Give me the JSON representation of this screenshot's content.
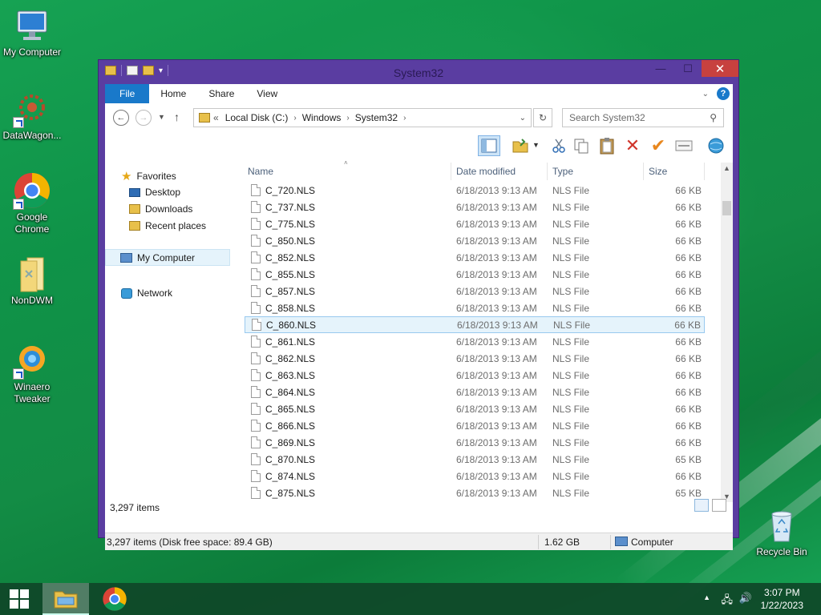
{
  "desktop": {
    "icons": [
      {
        "label": "My Computer"
      },
      {
        "label": "DataWagon..."
      },
      {
        "label": "Google Chrome"
      },
      {
        "label": "NonDWM"
      },
      {
        "label": "Winaero Tweaker"
      },
      {
        "label": "Recycle Bin"
      }
    ]
  },
  "window": {
    "title": "System32",
    "controls": {
      "minimize": "—",
      "maximize": "☐",
      "close": "✕"
    },
    "ribbon_tabs": [
      "File",
      "Home",
      "Share",
      "View"
    ],
    "help": "?",
    "address": {
      "prefix": "«",
      "crumbs": [
        "Local Disk (C:)",
        "Windows",
        "System32"
      ]
    },
    "search_placeholder": "Search System32",
    "nav": {
      "favorites": "Favorites",
      "desktop": "Desktop",
      "downloads": "Downloads",
      "recent": "Recent places",
      "computer": "My Computer",
      "network": "Network"
    },
    "columns": {
      "name": "Name",
      "date": "Date modified",
      "type": "Type",
      "size": "Size"
    },
    "files": [
      {
        "name": "C_720.NLS",
        "date": "6/18/2013 9:13 AM",
        "type": "NLS File",
        "size": "66 KB"
      },
      {
        "name": "C_737.NLS",
        "date": "6/18/2013 9:13 AM",
        "type": "NLS File",
        "size": "66 KB"
      },
      {
        "name": "C_775.NLS",
        "date": "6/18/2013 9:13 AM",
        "type": "NLS File",
        "size": "66 KB"
      },
      {
        "name": "C_850.NLS",
        "date": "6/18/2013 9:13 AM",
        "type": "NLS File",
        "size": "66 KB"
      },
      {
        "name": "C_852.NLS",
        "date": "6/18/2013 9:13 AM",
        "type": "NLS File",
        "size": "66 KB"
      },
      {
        "name": "C_855.NLS",
        "date": "6/18/2013 9:13 AM",
        "type": "NLS File",
        "size": "66 KB"
      },
      {
        "name": "C_857.NLS",
        "date": "6/18/2013 9:13 AM",
        "type": "NLS File",
        "size": "66 KB"
      },
      {
        "name": "C_858.NLS",
        "date": "6/18/2013 9:13 AM",
        "type": "NLS File",
        "size": "66 KB"
      },
      {
        "name": "C_860.NLS",
        "date": "6/18/2013 9:13 AM",
        "type": "NLS File",
        "size": "66 KB"
      },
      {
        "name": "C_861.NLS",
        "date": "6/18/2013 9:13 AM",
        "type": "NLS File",
        "size": "66 KB"
      },
      {
        "name": "C_862.NLS",
        "date": "6/18/2013 9:13 AM",
        "type": "NLS File",
        "size": "66 KB"
      },
      {
        "name": "C_863.NLS",
        "date": "6/18/2013 9:13 AM",
        "type": "NLS File",
        "size": "66 KB"
      },
      {
        "name": "C_864.NLS",
        "date": "6/18/2013 9:13 AM",
        "type": "NLS File",
        "size": "66 KB"
      },
      {
        "name": "C_865.NLS",
        "date": "6/18/2013 9:13 AM",
        "type": "NLS File",
        "size": "66 KB"
      },
      {
        "name": "C_866.NLS",
        "date": "6/18/2013 9:13 AM",
        "type": "NLS File",
        "size": "66 KB"
      },
      {
        "name": "C_869.NLS",
        "date": "6/18/2013 9:13 AM",
        "type": "NLS File",
        "size": "66 KB"
      },
      {
        "name": "C_870.NLS",
        "date": "6/18/2013 9:13 AM",
        "type": "NLS File",
        "size": "65 KB"
      },
      {
        "name": "C_874.NLS",
        "date": "6/18/2013 9:13 AM",
        "type": "NLS File",
        "size": "66 KB"
      },
      {
        "name": "C_875.NLS",
        "date": "6/18/2013 9:13 AM",
        "type": "NLS File",
        "size": "65 KB"
      }
    ],
    "selected_file": "C_860.NLS",
    "items_count": "3,297 items",
    "status": {
      "summary": "3,297 items (Disk free space: 89.4 GB)",
      "size": "1.62 GB",
      "location": "Computer"
    }
  },
  "taskbar": {
    "time": "3:07 PM",
    "date": "1/22/2023",
    "tray_expand": "▲"
  },
  "colors": {
    "title_bar": "#5a3da1",
    "file_tab": "#1979ca",
    "close_button": "#c7413f",
    "selection": "#e5f3fb",
    "desktop": "#16a253"
  }
}
